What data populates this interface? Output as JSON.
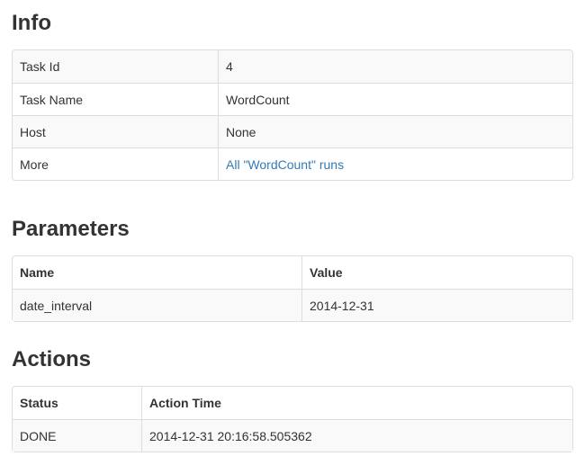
{
  "info": {
    "heading": "Info",
    "rows": [
      {
        "label": "Task Id",
        "value": "4"
      },
      {
        "label": "Task Name",
        "value": "WordCount"
      },
      {
        "label": "Host",
        "value": "None"
      },
      {
        "label": "More",
        "value": "All \"WordCount\" runs"
      }
    ]
  },
  "parameters": {
    "heading": "Parameters",
    "columns": [
      "Name",
      "Value"
    ],
    "rows": [
      {
        "name": "date_interval",
        "value": "2014-12-31"
      }
    ]
  },
  "actions": {
    "heading": "Actions",
    "columns": [
      "Status",
      "Action Time"
    ],
    "rows": [
      {
        "status": "DONE",
        "time": "2014-12-31 20:16:58.505362"
      }
    ]
  },
  "colors": {
    "link": "#337ab7",
    "border": "#dddddd",
    "stripe": "#f9f9f9"
  }
}
